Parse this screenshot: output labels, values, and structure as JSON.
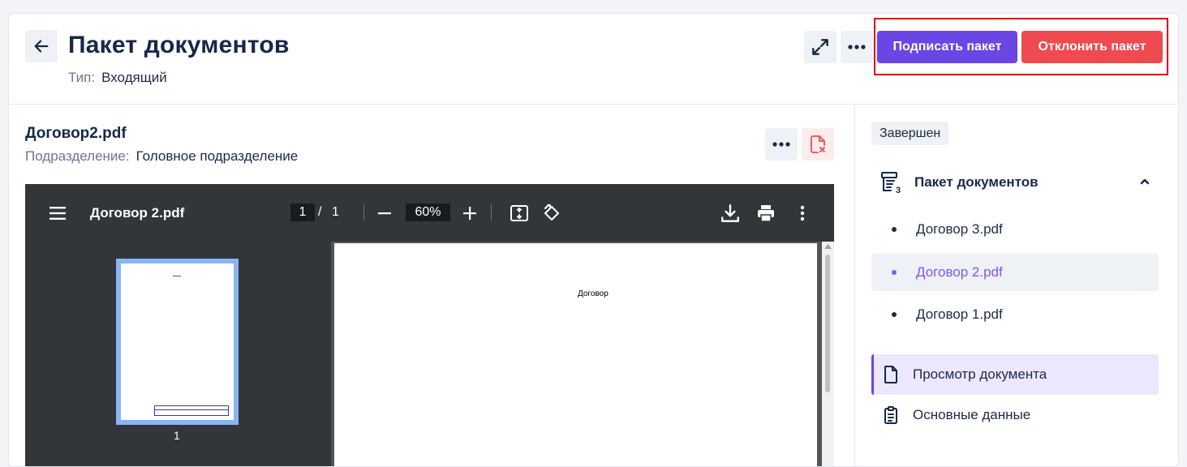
{
  "header": {
    "title": "Пакет документов",
    "type_label": "Тип:",
    "type_value": "Входящий",
    "sign_button": "Подписать пакет",
    "reject_button": "Отклонить пакет"
  },
  "document": {
    "name": "Договор2.pdf",
    "subdivision_label": "Подразделение:",
    "subdivision_value": "Головное подразделение"
  },
  "viewer": {
    "filename": "Договор 2.pdf",
    "current_page": "1",
    "page_separator": "/",
    "total_pages": "1",
    "zoom": "60%",
    "thumbnail_number": "1",
    "page_text": "Договор"
  },
  "sidebar": {
    "status": "Завершен",
    "package_title": "Пакет документов",
    "package_count": "3",
    "documents": [
      {
        "label": "Договор 3.pdf",
        "active": false
      },
      {
        "label": "Договор 2.pdf",
        "active": true
      },
      {
        "label": "Договор 1.pdf",
        "active": false
      }
    ],
    "nav": [
      {
        "label": "Просмотр документа",
        "icon": "file-icon",
        "active": true
      },
      {
        "label": "Основные данные",
        "icon": "clipboard-icon",
        "active": false
      }
    ]
  },
  "colors": {
    "accent": "#6b46e5",
    "danger": "#ef4a4f",
    "active_text": "#7a5af0",
    "highlight_box": "#e00000"
  }
}
